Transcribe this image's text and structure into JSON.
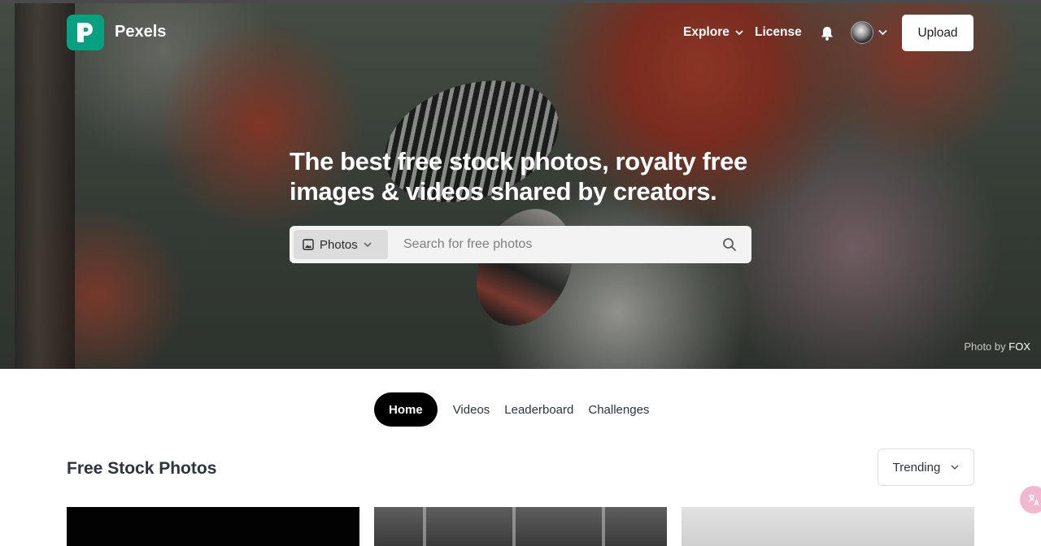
{
  "header": {
    "brand": "Pexels",
    "nav": {
      "explore": "Explore",
      "license": "License"
    },
    "upload_label": "Upload",
    "icons": {
      "logo": "pexels-logo-icon",
      "bell": "bell-icon",
      "avatar": "user-avatar",
      "chevron": "chevron-down-icon"
    }
  },
  "hero": {
    "headline": "The best free stock photos, royalty free images & videos shared by creators.",
    "search": {
      "type_label": "Photos",
      "placeholder": "Search for free photos"
    },
    "credit": {
      "prefix": "Photo by",
      "author": "FOX"
    }
  },
  "tabs": [
    {
      "label": "Home",
      "active": true
    },
    {
      "label": "Videos",
      "active": false
    },
    {
      "label": "Leaderboard",
      "active": false
    },
    {
      "label": "Challenges",
      "active": false
    }
  ],
  "section": {
    "title": "Free Stock Photos",
    "sort_label": "Trending"
  },
  "colors": {
    "brand": "#07a081",
    "accent_tab": "#000000"
  }
}
